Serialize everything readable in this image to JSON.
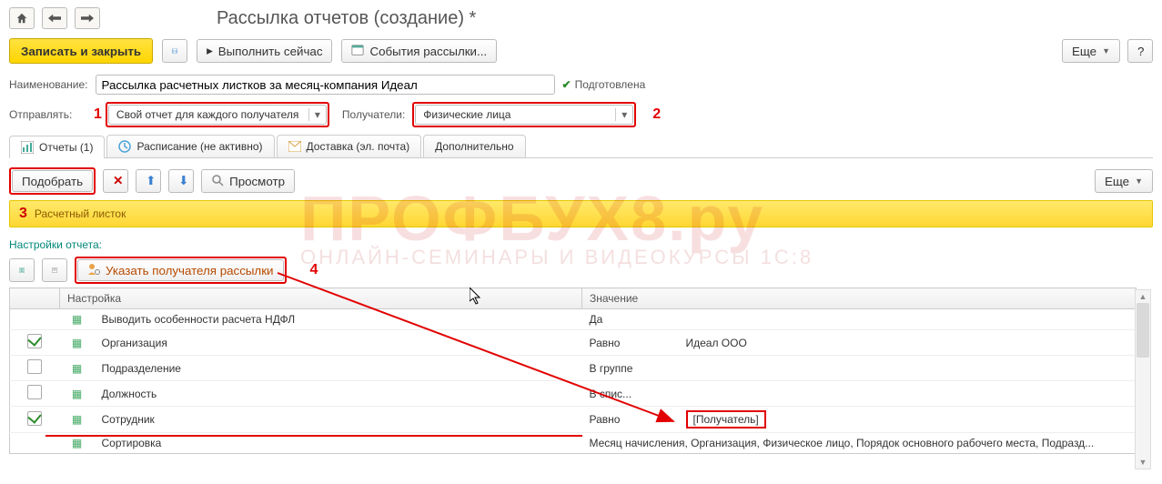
{
  "page_title": "Рассылка отчетов (создание) *",
  "cmdbar": {
    "save_close": "Записать и закрыть",
    "execute_now": "Выполнить сейчас",
    "events": "События рассылки...",
    "more": "Еще"
  },
  "fields": {
    "name_label": "Наименование:",
    "name_value": "Рассылка расчетных листков за месяц-компания Идеал",
    "prepared_label": "Подготовлена",
    "send_label": "Отправлять:",
    "send_value": "Свой отчет для каждого получателя",
    "recipients_label": "Получатели:",
    "recipients_value": "Физические лица"
  },
  "annotations": {
    "n1": "1",
    "n2": "2",
    "n3": "3",
    "n4": "4"
  },
  "tabs": {
    "reports": "Отчеты (1)",
    "schedule": "Расписание (не активно)",
    "delivery": "Доставка (эл. почта)",
    "additional": "Дополнительно"
  },
  "panel_bar": {
    "select": "Подобрать",
    "preview": "Просмотр",
    "more": "Еще"
  },
  "yellow_strip": "Расчетный листок",
  "settings": {
    "title": "Настройки отчета:",
    "specify_recipient": "Указать получателя рассылки"
  },
  "table": {
    "col_setting": "Настройка",
    "col_value": "Значение",
    "rows": [
      {
        "checked": "none",
        "name": "Выводить особенности расчета НДФЛ",
        "value": "Да"
      },
      {
        "checked": "true",
        "name": "Организация",
        "value": "Равно",
        "value2": "Идеал ООО"
      },
      {
        "checked": "false",
        "name": "Подразделение",
        "value": "В группе"
      },
      {
        "checked": "false",
        "name": "Должность",
        "value": "В спис..."
      },
      {
        "checked": "true",
        "name": "Сотрудник",
        "value": "Равно",
        "value2": "[Получатель]"
      },
      {
        "checked": "none",
        "name": "Сортировка",
        "value": "Месяц начисления, Организация, Физическое лицо, Порядок основного рабочего места, Подразд..."
      }
    ]
  },
  "watermark": {
    "big": "ПРОФБУХ8.ру",
    "small": "ОНЛАЙН-СЕМИНАРЫ И ВИДЕОКУРСЫ 1С:8"
  }
}
